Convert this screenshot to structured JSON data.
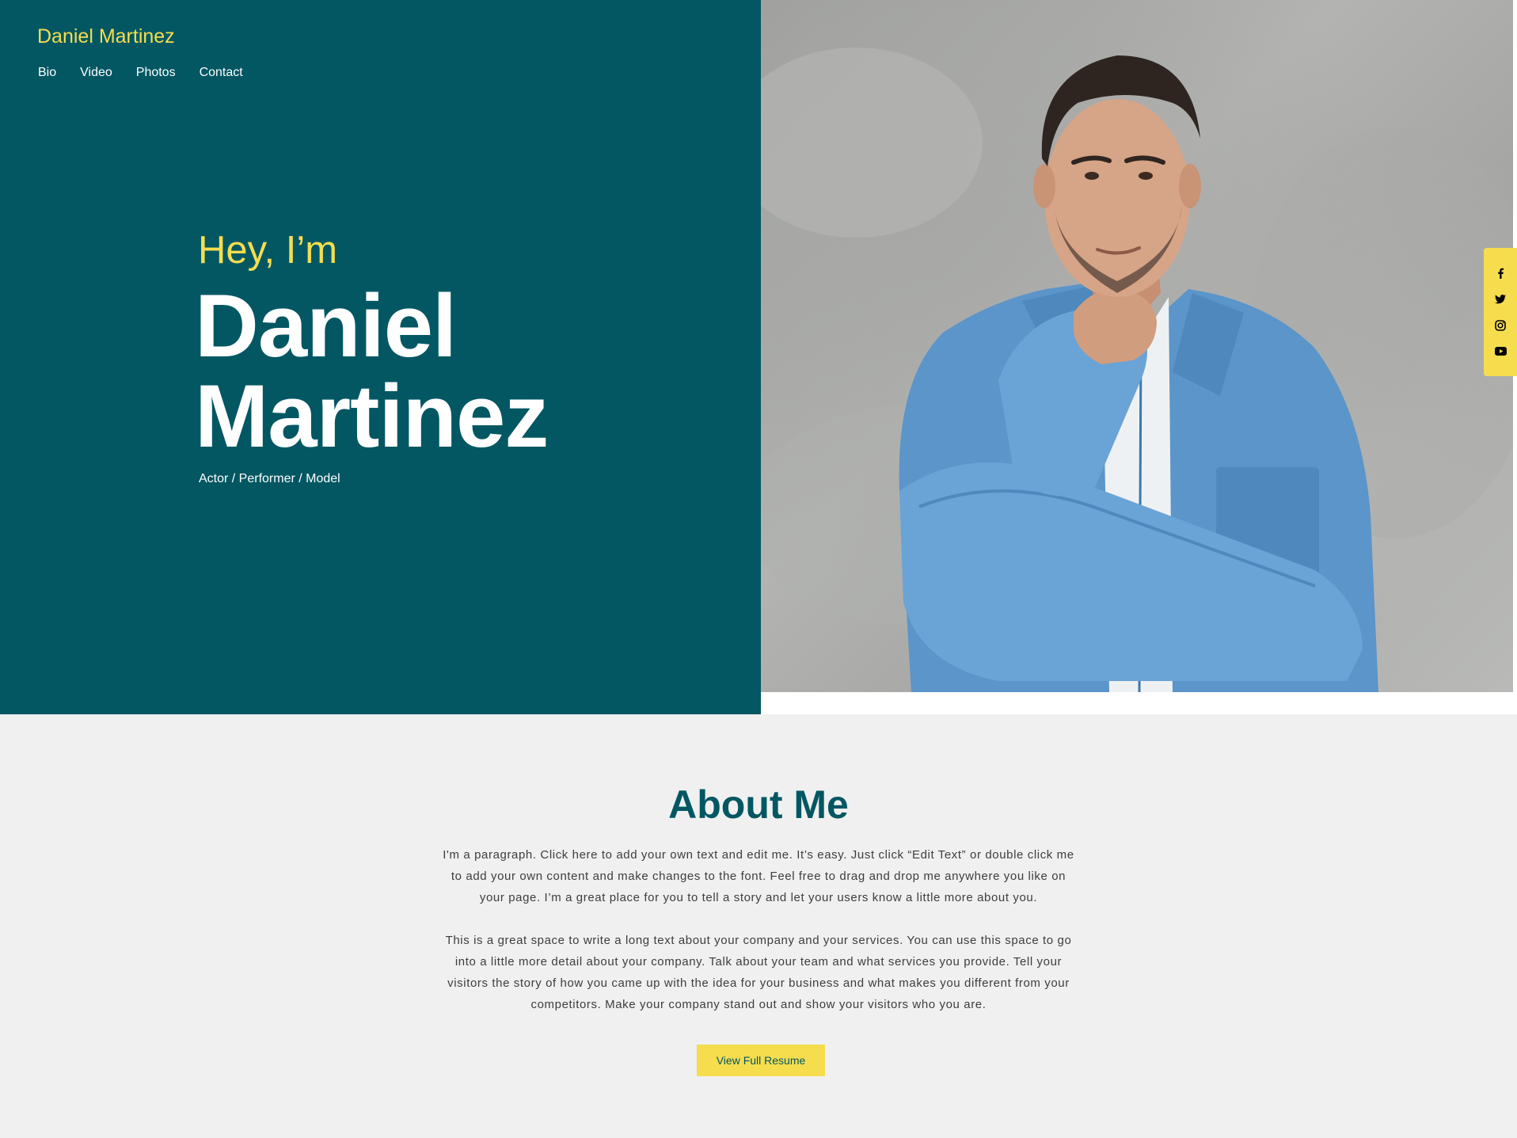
{
  "header": {
    "site_title": "Daniel Martinez",
    "nav": [
      "Bio",
      "Video",
      "Photos",
      "Contact"
    ]
  },
  "hero": {
    "greeting": "Hey, I’m",
    "name_line1": "Daniel",
    "name_line2": "Martinez",
    "tagline": "Actor / Performer / Model"
  },
  "social": {
    "icons": [
      "facebook-icon",
      "twitter-icon",
      "instagram-icon",
      "youtube-icon"
    ]
  },
  "about": {
    "title": "About Me",
    "paragraph1": "I'm a paragraph. Click here to add your own text and edit me. It’s easy. Just click “Edit Text” or double click me to add your own content and make changes to the font. Feel free to drag and drop me anywhere you like on your page. I’m a great place for you to tell a story and let your users know a little more about you.",
    "paragraph2": "This is a great space to write a long text about your company and your services. You can use this space to go into a little more detail about your company. Talk about your team and what services you provide. Tell your visitors the story of how you came up with the idea for your business and what makes you different from your competitors. Make your company stand out and show your visitors who you are.",
    "resume_button": "View Full Resume"
  },
  "colors": {
    "teal": "#025763",
    "yellow": "#f5dd4e",
    "background": "#f0f0f0"
  }
}
